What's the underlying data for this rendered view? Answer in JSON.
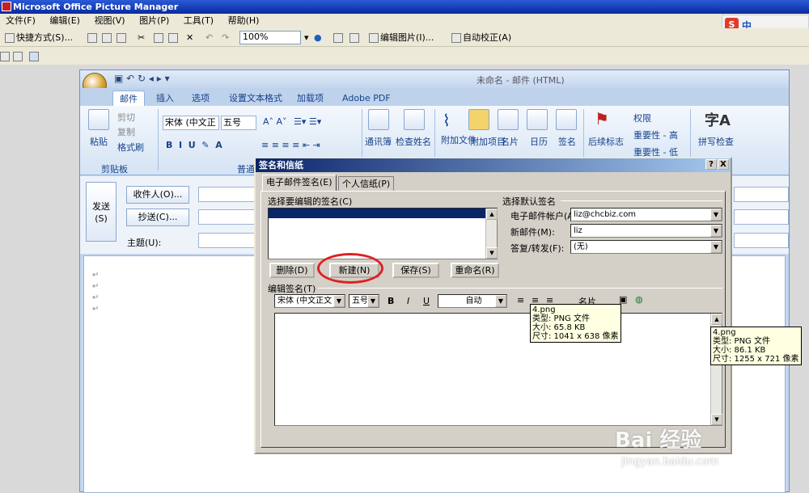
{
  "app": {
    "title": "Microsoft Office Picture Manager"
  },
  "menubar": [
    "文件(F)",
    "编辑(E)",
    "视图(V)",
    "图片(P)",
    "工具(T)",
    "帮助(H)"
  ],
  "toolbar": {
    "shortcuts": "快捷方式(S)...",
    "zoom": "100%",
    "edit_pictures": "编辑图片(I)...",
    "auto_correct": "自动校正(A)"
  },
  "ime": {
    "logo": "S",
    "label": "中"
  },
  "outlook": {
    "title": "未命名 - 邮件 (HTML)",
    "tabs": [
      "邮件",
      "插入",
      "选项",
      "设置文本格式",
      "加载项",
      "Adobe PDF"
    ],
    "active_tab": "邮件",
    "ribbon": {
      "paste": "粘贴",
      "cut": "剪切",
      "copy": "复制",
      "format_painter": "格式刷",
      "clipboard_group": "剪贴板",
      "basic_text_group": "普通",
      "font": "宋体 (中文正",
      "font_size": "五号",
      "address_book": "通讯簿",
      "check_names": "检查姓名",
      "attach_file": "附加文件",
      "attach_item": "附加项目",
      "business_card": "名片",
      "calendar": "日历",
      "signature": "签名",
      "follow_up": "后续标志",
      "permission": "权限",
      "high_importance": "重要性 - 高",
      "low_importance": "重要性 - 低",
      "spelling": "拼写检查"
    },
    "compose": {
      "send": "发送",
      "send_key": "(S)",
      "to": "收件人(O)...",
      "cc": "抄送(C)...",
      "subject": "主题(U):"
    }
  },
  "dialog": {
    "title": "签名和信纸",
    "help": "?",
    "close": "X",
    "tabs": [
      "电子邮件签名(E)",
      "个人信纸(P)"
    ],
    "select_label": "选择要编辑的签名(C)",
    "buttons": {
      "delete": "删除(D)",
      "new": "新建(N)",
      "save": "保存(S)",
      "rename": "重命名(R)"
    },
    "default_label": "选择默认签名",
    "account_label": "电子邮件帐户(A):",
    "account_value": "liz@chcbiz.com",
    "new_msg_label": "新邮件(M):",
    "new_msg_value": "liz",
    "reply_label": "答复/转发(F):",
    "reply_value": "(无)",
    "edit_label": "编辑签名(T)",
    "edit_font": "宋体 (中文正文",
    "edit_size": "五号",
    "bold": "B",
    "italic": "I",
    "underline": "U",
    "color": "自动",
    "business_card": "名片"
  },
  "tooltips": [
    {
      "name": "4.png",
      "type": "类型: PNG 文件",
      "size": "大小: 65.8 KB",
      "dims": "尺寸: 1041 x 638 像素"
    },
    {
      "name": "4.png",
      "type": "类型: PNG 文件",
      "size": "大小: 86.1 KB",
      "dims": "尺寸: 1255 x 721 像素"
    }
  ],
  "watermark": {
    "logo": "Bai 经验",
    "url": "jingyan.baidu.com"
  },
  "colors": {
    "titlebar": "#0a2aa0",
    "dialog_title": "#0a246a",
    "ribbon_text": "#15428b",
    "highlight": "#e02020"
  }
}
